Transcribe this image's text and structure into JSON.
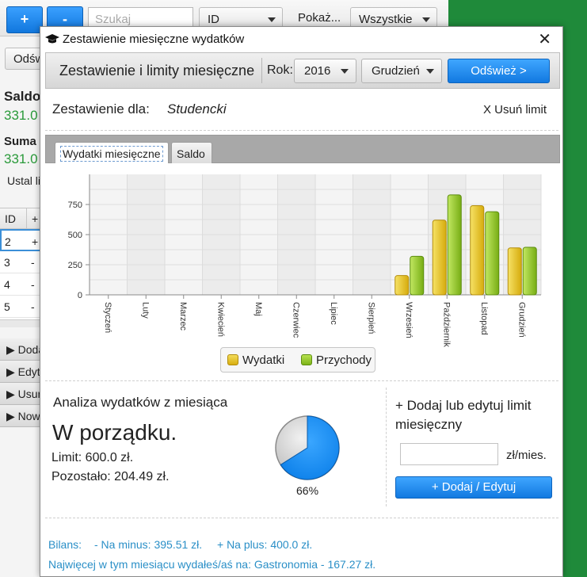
{
  "background": {
    "add_label": "+",
    "remove_label": "-",
    "search_placeholder": "Szukaj",
    "field_combo": "ID",
    "show_label": "Pokaż...",
    "filter_combo": "Wszystkie",
    "refresh_label": "Odśwież",
    "saldo_title": "Saldo",
    "saldo_value": "331.0",
    "suma_title": "Suma",
    "suma_value": "331.0",
    "limit_text": "Ustal limit",
    "table_headers": [
      "ID",
      "+"
    ],
    "table_rows": [
      [
        "2",
        "+"
      ],
      [
        "3",
        "-"
      ],
      [
        "4",
        "-"
      ],
      [
        "5",
        "-"
      ]
    ],
    "accordion": [
      "Dodaj",
      "Edytuj",
      "Usuń",
      "Nowy"
    ]
  },
  "dialog": {
    "title": "Zestawienie miesięczne wydatków",
    "toolbar": {
      "title": "Zestawienie i limity miesięczne",
      "year_label": "Rok:",
      "year": "2016",
      "month": "Grudzień",
      "refresh": "Odśwież >"
    },
    "summary_label": "Zestawienie dla:",
    "summary_name": "Studencki",
    "remove_limit": "X Usuń limit",
    "tabs": [
      "Wydatki miesięczne",
      "Saldo"
    ],
    "analysis": {
      "title": "Analiza wydatków z miesiąca",
      "status": "W porządku.",
      "limit": "Limit: 600.0 zł.",
      "remaining": "Pozostało: 204.49 zł.",
      "percent_label": "66%",
      "percent": 66
    },
    "add_limit": {
      "title": "+ Dodaj lub edytuj limit miesięczny",
      "unit": "zł/mies.",
      "button": "+ Dodaj / Edytuj"
    },
    "footer": {
      "bilans": "Bilans:",
      "minus": "- Na minus: 395.51 zł.",
      "plus": "+ Na plus: 400.0 zł.",
      "most": "Najwięcej w tym miesiącu wydałeś/aś na: Gastronomia - 167.27 zł."
    }
  },
  "chart_data": {
    "type": "bar",
    "categories": [
      "Styczeń",
      "Luty",
      "Marzec",
      "Kwiecień",
      "Maj",
      "Czerwiec",
      "Lipiec",
      "Sierpień",
      "Wrzesień",
      "Październik",
      "Listopad",
      "Grudzień"
    ],
    "series": [
      {
        "name": "Wydatki",
        "color": "#e8c21a",
        "values": [
          0,
          0,
          0,
          0,
          0,
          0,
          0,
          0,
          160,
          620,
          740,
          390
        ]
      },
      {
        "name": "Przychody",
        "color": "#8cc71e",
        "values": [
          0,
          0,
          0,
          0,
          0,
          0,
          0,
          0,
          320,
          830,
          690,
          395
        ]
      }
    ],
    "yticks": [
      0,
      250,
      500,
      750
    ],
    "ylim": [
      0,
      1000
    ],
    "grid": true,
    "legend": "bottom"
  }
}
